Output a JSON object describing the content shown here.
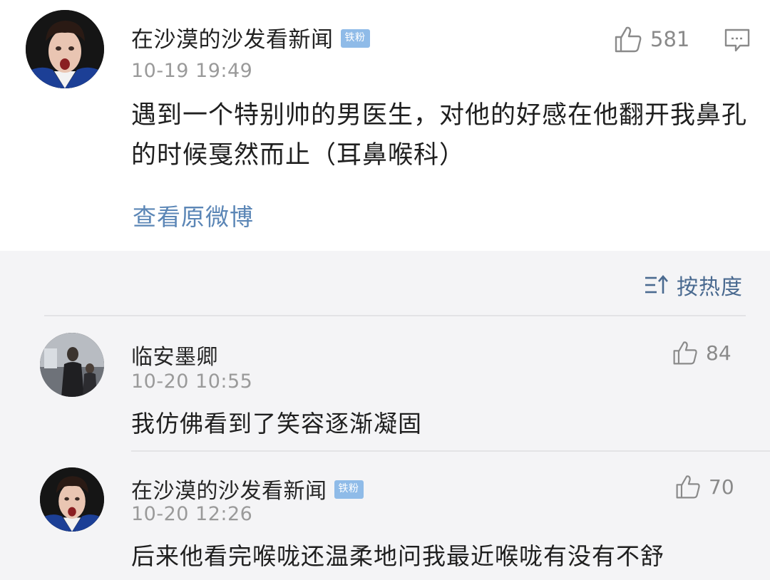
{
  "main_post": {
    "username": "在沙漠的沙发看新闻",
    "badge": "铁粉",
    "timestamp": "10-19 19:49",
    "like_count": "581",
    "body": "遇到一个特别帅的男医生，对他的好感在他翻开我鼻孔的时候戛然而止（耳鼻喉科）",
    "view_original": "查看原微博"
  },
  "comments_header": {
    "sort_label": "按热度"
  },
  "comments": [
    {
      "username": "临安墨卿",
      "timestamp": "10-20 10:55",
      "like_count": "84",
      "text": "我仿佛看到了笑容逐渐凝固"
    },
    {
      "username": "在沙漠的沙发看新闻",
      "badge": "铁粉",
      "timestamp": "10-20 12:26",
      "like_count": "70",
      "text": "后来他看完喉咙还温柔地问我最近喉咙有没有不舒"
    }
  ],
  "icons": {
    "like": "thumbs-up-icon",
    "comment": "comment-icon",
    "sort": "sort-icon"
  },
  "colors": {
    "link": "#5b86b6",
    "badge": "#8fbbe8",
    "timestamp": "#9a9a9a",
    "section_bg": "#f4f4f6"
  }
}
